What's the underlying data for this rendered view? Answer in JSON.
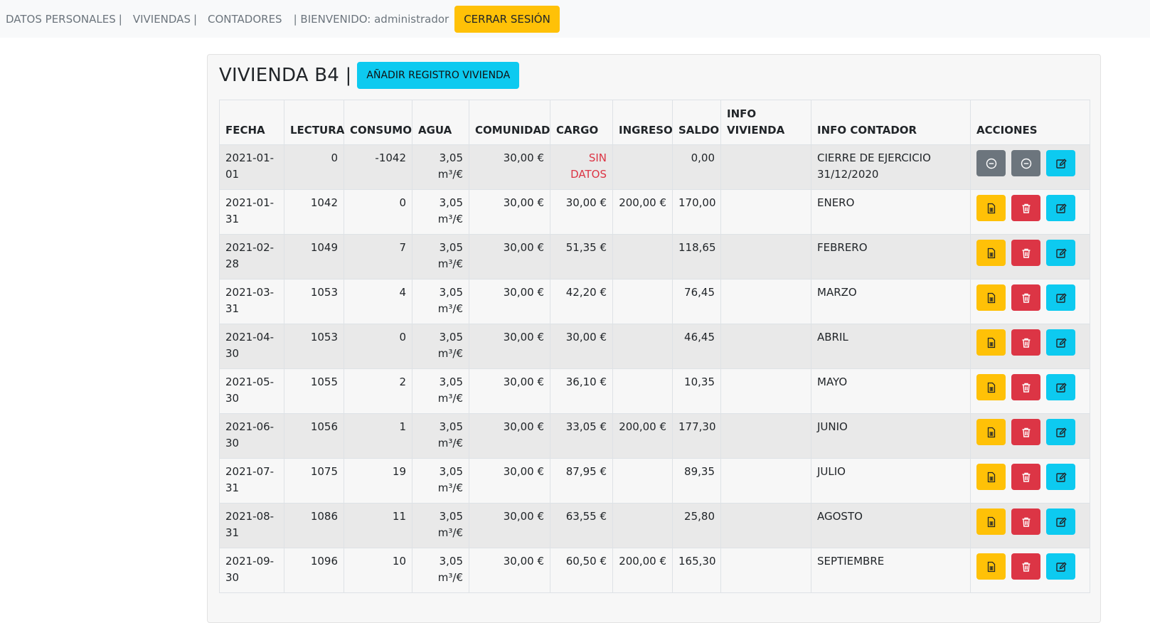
{
  "nav": {
    "datos_personales": "DATOS PERSONALES",
    "viviendas": "VIVIENDAS",
    "contadores": "CONTADORES",
    "separator": "|",
    "welcome": "| BIENVENIDO: administrador",
    "logout": "CERRAR SESIÓN"
  },
  "page": {
    "title": "VIVIENDA B4 |",
    "add_button": "AÑADIR REGISTRO VIVIENDA"
  },
  "table": {
    "headers": {
      "fecha": "FECHA",
      "lectura": "LECTURA",
      "consumo": "CONSUMO",
      "agua": "AGUA",
      "comunidad": "COMUNIDAD",
      "cargo": "CARGO",
      "ingreso": "INGRESO",
      "saldo": "SALDO",
      "info_vivienda": "INFO VIVIENDA",
      "info_contador": "INFO CONTADOR",
      "acciones": "ACCIONES"
    },
    "rows": [
      {
        "fecha": "2021-01-01",
        "lectura": "0",
        "consumo": "-1042",
        "agua": "3,05 m³/€",
        "comunidad": "30,00 €",
        "cargo": "SIN DATOS",
        "ingreso": "",
        "saldo": "0,00",
        "info_vivienda": "",
        "info_contador": "CIERRE DE EJERCICIO 31/12/2020"
      },
      {
        "fecha": "2021-01-31",
        "lectura": "1042",
        "consumo": "0",
        "agua": "3,05 m³/€",
        "comunidad": "30,00 €",
        "cargo": "30,00 €",
        "ingreso": "200,00 €",
        "saldo": "170,00",
        "info_vivienda": "",
        "info_contador": "ENERO"
      },
      {
        "fecha": "2021-02-28",
        "lectura": "1049",
        "consumo": "7",
        "agua": "3,05 m³/€",
        "comunidad": "30,00 €",
        "cargo": "51,35 €",
        "ingreso": "",
        "saldo": "118,65",
        "info_vivienda": "",
        "info_contador": "FEBRERO"
      },
      {
        "fecha": "2021-03-31",
        "lectura": "1053",
        "consumo": "4",
        "agua": "3,05 m³/€",
        "comunidad": "30,00 €",
        "cargo": "42,20 €",
        "ingreso": "",
        "saldo": "76,45",
        "info_vivienda": "",
        "info_contador": "MARZO"
      },
      {
        "fecha": "2021-04-30",
        "lectura": "1053",
        "consumo": "0",
        "agua": "3,05 m³/€",
        "comunidad": "30,00 €",
        "cargo": "30,00 €",
        "ingreso": "",
        "saldo": "46,45",
        "info_vivienda": "",
        "info_contador": "ABRIL"
      },
      {
        "fecha": "2021-05-30",
        "lectura": "1055",
        "consumo": "2",
        "agua": "3,05 m³/€",
        "comunidad": "30,00 €",
        "cargo": "36,10 €",
        "ingreso": "",
        "saldo": "10,35",
        "info_vivienda": "",
        "info_contador": "MAYO"
      },
      {
        "fecha": "2021-06-30",
        "lectura": "1056",
        "consumo": "1",
        "agua": "3,05 m³/€",
        "comunidad": "30,00 €",
        "cargo": "33,05 €",
        "ingreso": "200,00 €",
        "saldo": "177,30",
        "info_vivienda": "",
        "info_contador": "JUNIO"
      },
      {
        "fecha": "2021-07-31",
        "lectura": "1075",
        "consumo": "19",
        "agua": "3,05 m³/€",
        "comunidad": "30,00 €",
        "cargo": "87,95 €",
        "ingreso": "",
        "saldo": "89,35",
        "info_vivienda": "",
        "info_contador": "JULIO"
      },
      {
        "fecha": "2021-08-31",
        "lectura": "1086",
        "consumo": "11",
        "agua": "3,05 m³/€",
        "comunidad": "30,00 €",
        "cargo": "63,55 €",
        "ingreso": "",
        "saldo": "25,80",
        "info_vivienda": "",
        "info_contador": "AGOSTO"
      },
      {
        "fecha": "2021-09-30",
        "lectura": "1096",
        "consumo": "10",
        "agua": "3,05 m³/€",
        "comunidad": "30,00 €",
        "cargo": "60,50 €",
        "ingreso": "200,00 €",
        "saldo": "165,30",
        "info_vivienda": "",
        "info_contador": "SEPTIEMBRE"
      }
    ]
  },
  "actions": {
    "first_row": [
      "minus-circle-icon",
      "minus-circle-icon",
      "edit-icon"
    ],
    "other_rows": [
      "invoice-icon",
      "trash-icon",
      "edit-icon"
    ]
  },
  "colors": {
    "warning": "#ffc107",
    "danger": "#dc3545",
    "info": "#0dcaf0",
    "secondary": "#6c757d"
  }
}
